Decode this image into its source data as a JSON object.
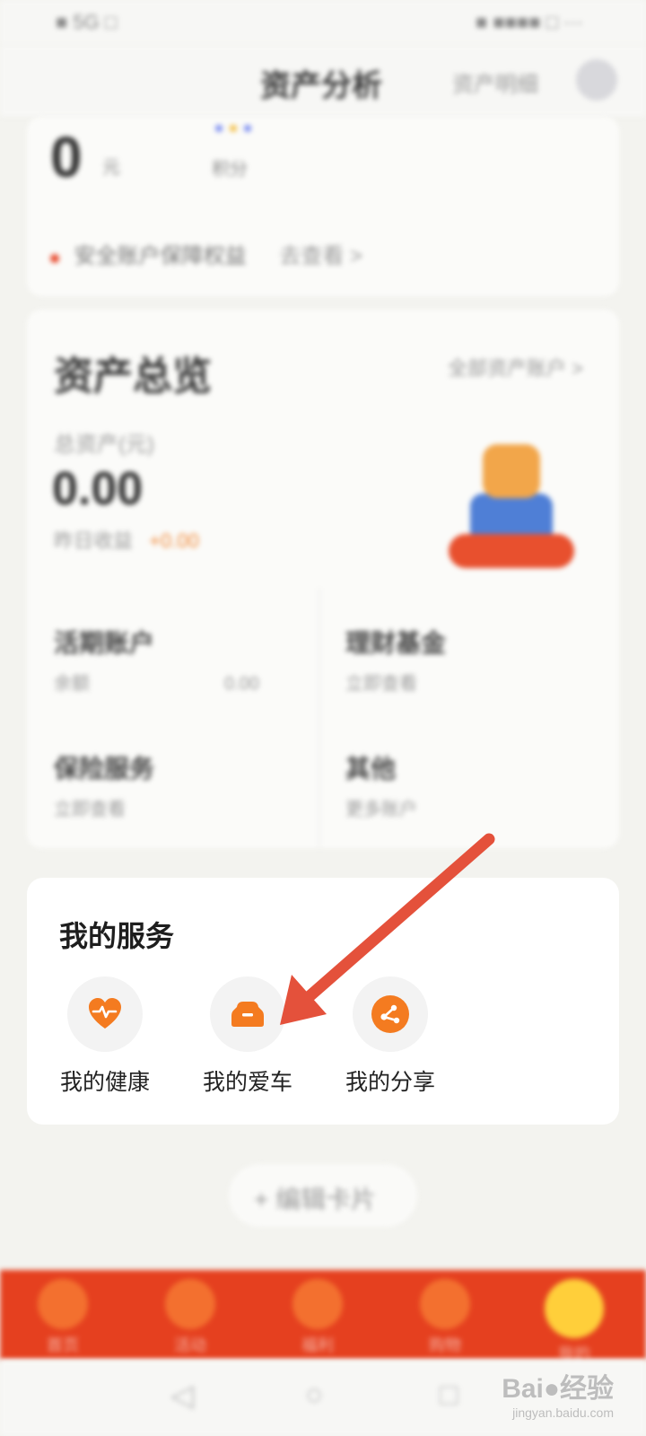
{
  "status_bar": {
    "left": "■ 5G □",
    "right": "■ ■■■■ □ ···"
  },
  "header": {
    "title": "资产分析",
    "link": "资产明细"
  },
  "top_card": {
    "big_value": "0",
    "unit": "元",
    "mini_label": "积分",
    "notice": "安全账户保障权益",
    "notice_link": "去查看 >"
  },
  "asset_card": {
    "title": "资产总览",
    "right_link": "全部资产账户 >",
    "label": "总资产(元)",
    "value": "0.00",
    "sub": "昨日收益",
    "sub_tag": "+0.00",
    "grid": [
      {
        "title": "活期账户",
        "sub": "余额",
        "extra": "0.00"
      },
      {
        "title": "理财基金",
        "sub": "立即查看"
      },
      {
        "title": "保险服务",
        "sub": "立即查看"
      },
      {
        "title": "其他",
        "sub": "更多账户"
      }
    ]
  },
  "services": {
    "title": "我的服务",
    "items": [
      {
        "label": "我的健康",
        "icon": "heart-pulse-icon"
      },
      {
        "label": "我的爱车",
        "icon": "car-icon"
      },
      {
        "label": "我的分享",
        "icon": "share-icon"
      }
    ]
  },
  "edit_button": {
    "label": "+ 编辑卡片"
  },
  "bottom_nav": {
    "items": [
      "首页",
      "活动",
      "福利",
      "购物",
      "我的"
    ]
  },
  "watermark": {
    "main": "Bai●经验",
    "sub": "jingyan.baidu.com"
  },
  "colors": {
    "accent": "#f47b20",
    "nav_red": "#e5401f",
    "arrow": "#e4513b"
  }
}
